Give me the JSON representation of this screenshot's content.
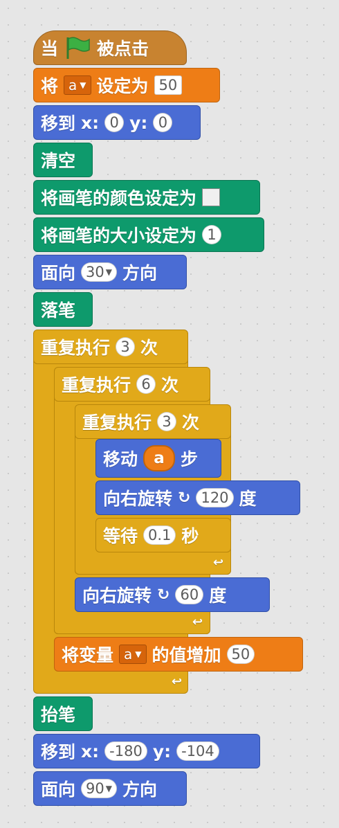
{
  "blocks": {
    "b1": {
      "pre": "当",
      "post": "被点击"
    },
    "b2": {
      "pre": "将",
      "var": "a",
      "post": "设定为",
      "value": "50"
    },
    "b3": {
      "label": "移到",
      "x_label": "x:",
      "x": "0",
      "y_label": "y:",
      "y": "0"
    },
    "b4": {
      "label": "清空"
    },
    "b5": {
      "label": "将画笔的颜色设定为"
    },
    "b6": {
      "label": "将画笔的大小设定为",
      "value": "1"
    },
    "b7": {
      "pre": "面向",
      "value": "30",
      "post": "方向"
    },
    "b8": {
      "label": "落笔"
    },
    "b9": {
      "pre": "重复执行",
      "value": "3",
      "post": "次"
    },
    "b10": {
      "pre": "重复执行",
      "value": "6",
      "post": "次"
    },
    "b11": {
      "pre": "重复执行",
      "value": "3",
      "post": "次"
    },
    "b12": {
      "pre": "移动",
      "var": "a",
      "post": "步"
    },
    "b13": {
      "pre": "向右旋转",
      "value": "120",
      "post": "度"
    },
    "b14": {
      "pre": "等待",
      "value": "0.1",
      "post": "秒"
    },
    "b15": {
      "pre": "向右旋转",
      "value": "60",
      "post": "度"
    },
    "b16": {
      "pre": "将变量",
      "var": "a",
      "post": "的值增加",
      "value": "50"
    },
    "b17": {
      "label": "抬笔"
    },
    "b18": {
      "label": "移到",
      "x_label": "x:",
      "x": "-180",
      "y_label": "y:",
      "y": "-104"
    },
    "b19": {
      "pre": "面向",
      "value": "90",
      "post": "方向"
    }
  },
  "icons": {
    "flag": "green-flag-icon",
    "turn": "turn-right-icon",
    "loop": "loop-arrow-icon",
    "dropdown": "dropdown-arrow-icon"
  },
  "colors": {
    "events": "#c88330",
    "data": "#ee7d16",
    "motion": "#4a6cd4",
    "pen": "#0e9a6c",
    "control": "#e1a91a",
    "flag": "#3cb043",
    "workspace": "#e6e6e6"
  }
}
